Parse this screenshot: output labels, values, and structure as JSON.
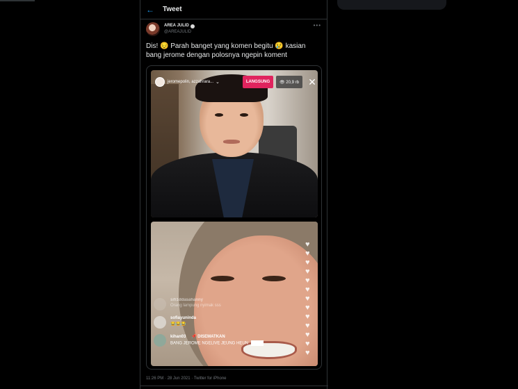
{
  "header": {
    "back_icon": "arrow-left-icon",
    "title": "Tweet"
  },
  "author": {
    "name": "AREA JULID",
    "handle": "@AREAJULID",
    "more_icon": "more-horizontal-icon"
  },
  "tweet": {
    "text": "Dis! 😔 Parah banget yang komen begitu 😢 kasian bang jerome dengan polosnya ngepin koment",
    "footer": "11:26 PM · 28 Jun 2021 · Twitter for iPhone"
  },
  "live": {
    "names": "jeromepolin, azzahrara...",
    "status_label": "LANGSUNG",
    "viewers": "👁 20,9 rb",
    "close_icon": "close-icon"
  },
  "comments": [
    {
      "user": "sifi1ddasahanny",
      "text": "Orang lampung nyimak sss",
      "faded": true
    },
    {
      "user": "sofiayuninda",
      "text": "😂😂😂",
      "faded": false
    },
    {
      "user": "kihan03",
      "pin_label": "📌 DISEMATKAN",
      "text": "BANG JEROME NGELIVE JEUNG HEUN",
      "faded": false
    }
  ],
  "colors": {
    "accent": "#1d9bf0",
    "live_badge": "#e0245e",
    "background": "#000000",
    "border": "#2f3336"
  }
}
